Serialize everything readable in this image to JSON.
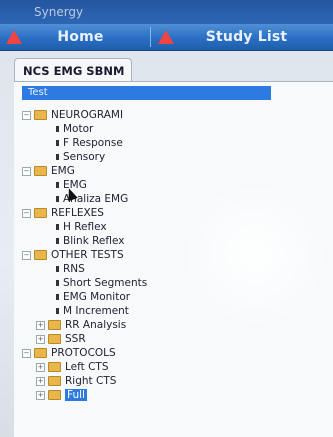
{
  "window": {
    "title": "Synergy"
  },
  "top_tabs": [
    {
      "label": "Home"
    },
    {
      "label": "Study List"
    }
  ],
  "panel": {
    "tab_label": "NCS EMG SBNM"
  },
  "list": {
    "header": "Test",
    "items": [
      {
        "label": "NEUROGRAMI",
        "type": "group"
      },
      {
        "label": "Motor",
        "type": "item"
      },
      {
        "label": "F Response",
        "type": "item"
      },
      {
        "label": "Sensory",
        "type": "item"
      },
      {
        "label": "EMG",
        "type": "group"
      },
      {
        "label": "EMG",
        "type": "item"
      },
      {
        "label": "Analiza EMG",
        "type": "item"
      },
      {
        "label": "REFLEXES",
        "type": "group"
      },
      {
        "label": "H Reflex",
        "type": "item"
      },
      {
        "label": "Blink Reflex",
        "type": "item"
      },
      {
        "label": "OTHER TESTS",
        "type": "group"
      },
      {
        "label": "RNS",
        "type": "item"
      },
      {
        "label": "Short Segments",
        "type": "item"
      },
      {
        "label": "EMG Monitor",
        "type": "item"
      },
      {
        "label": "M Increment",
        "type": "item"
      },
      {
        "label": "RR Analysis",
        "type": "subgroup"
      },
      {
        "label": "SSR",
        "type": "subgroup"
      },
      {
        "label": "PROTOCOLS",
        "type": "group"
      },
      {
        "label": "Left CTS",
        "type": "subgroup"
      },
      {
        "label": "Right CTS",
        "type": "subgroup"
      },
      {
        "label": "Full",
        "type": "subgroup-selected"
      }
    ]
  }
}
